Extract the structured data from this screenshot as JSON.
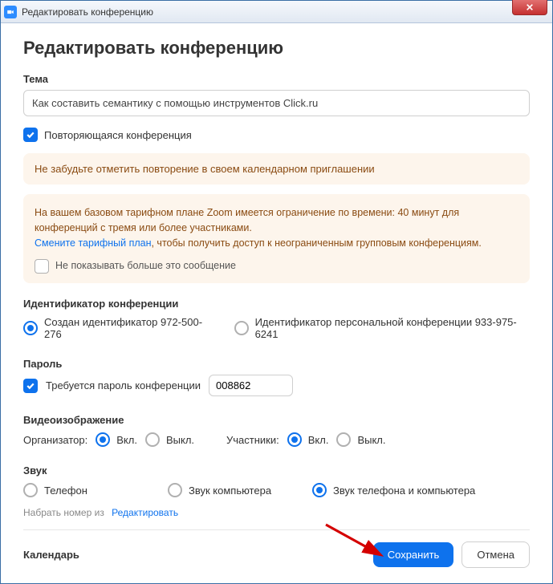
{
  "titlebar": {
    "title": "Редактировать конференцию"
  },
  "heading": "Редактировать конференцию",
  "topic": {
    "label": "Тема",
    "value": "Как составить семантику с помощью инструментов Click.ru"
  },
  "recurring": {
    "label": "Повторяющаяся конференция"
  },
  "warn_text": "Не забудьте отметить повторение в своем календарном приглашении",
  "plan": {
    "line1": "На вашем базовом тарифном плане Zoom имеется ограничение по времени: 40 минут для конференций с тремя или более участниками.",
    "link": "Смените тарифный план",
    "line2": ", чтобы получить доступ к неограниченным групповым конференциям.",
    "hide_label": "Не показывать больше это сообщение"
  },
  "meeting_id": {
    "label": "Идентификатор конференции",
    "opt1": "Создан идентификатор 972-500-276",
    "opt2": "Идентификатор персональной конференции 933-975-6241"
  },
  "password": {
    "label": "Пароль",
    "require_label": "Требуется пароль конференции",
    "value": "008862"
  },
  "video": {
    "label": "Видеоизображение",
    "host_label": "Организатор:",
    "participants_label": "Участники:",
    "on": "Вкл.",
    "off": "Выкл."
  },
  "audio": {
    "label": "Звук",
    "phone": "Телефон",
    "computer": "Звук компьютера",
    "both": "Звук телефона и компьютера",
    "dial_label": "Набрать номер из",
    "dial_edit": "Редактировать"
  },
  "calendar_label": "Календарь",
  "buttons": {
    "save": "Сохранить",
    "cancel": "Отмена"
  }
}
